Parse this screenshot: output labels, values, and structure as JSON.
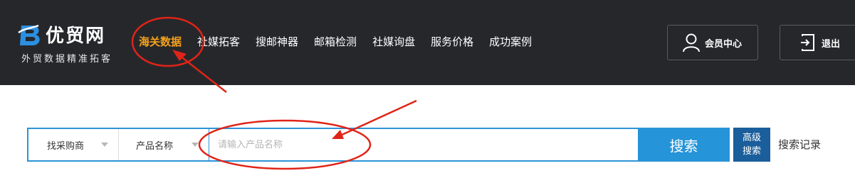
{
  "header": {
    "logo_name": "优贸网",
    "logo_tagline": "外贸数据精准拓客",
    "nav": [
      {
        "label": "海关数据",
        "active": true
      },
      {
        "label": "社媒拓客",
        "active": false
      },
      {
        "label": "搜邮神器",
        "active": false
      },
      {
        "label": "邮箱检测",
        "active": false
      },
      {
        "label": "社媒询盘",
        "active": false
      },
      {
        "label": "服务价格",
        "active": false
      },
      {
        "label": "成功案例",
        "active": false
      }
    ],
    "member_center_label": "会员中心",
    "logout_label": "退出"
  },
  "search": {
    "type_select": "找采购商",
    "field_select": "产品名称",
    "placeholder": "请输入产品名称",
    "button_label": "搜索",
    "advanced_line1": "高级",
    "advanced_line2": "搜索",
    "history_label": "搜索记录"
  },
  "colors": {
    "header_bg": "#26272b",
    "nav_active": "#f5a21c",
    "search_blue": "#2594d9",
    "advanced_blue": "#1a5e9c",
    "annotation_red": "#e02418"
  }
}
